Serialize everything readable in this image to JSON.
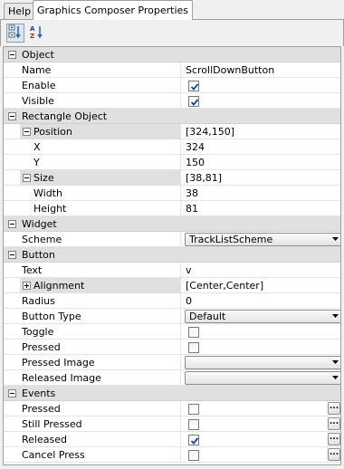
{
  "tabs": [
    {
      "label": "Help"
    },
    {
      "label": "Graphics Composer Properties"
    }
  ],
  "toolbar": {
    "categorized_icon": "categorized-view-icon",
    "alpha_icon": "alphabetical-sort-icon"
  },
  "categories": {
    "object": "Object",
    "rectangle": "Rectangle Object",
    "widget": "Widget",
    "button": "Button",
    "events": "Events"
  },
  "props": {
    "name": {
      "label": "Name",
      "value": "ScrollDownButton"
    },
    "enable": {
      "label": "Enable",
      "checked": true
    },
    "visible": {
      "label": "Visible",
      "checked": true
    },
    "position": {
      "label": "Position",
      "value": "[324,150]"
    },
    "x": {
      "label": "X",
      "value": "324"
    },
    "y": {
      "label": "Y",
      "value": "150"
    },
    "size": {
      "label": "Size",
      "value": "[38,81]"
    },
    "width": {
      "label": "Width",
      "value": "38"
    },
    "height": {
      "label": "Height",
      "value": "81"
    },
    "scheme": {
      "label": "Scheme",
      "value": "TrackListScheme"
    },
    "text": {
      "label": "Text",
      "value": "v"
    },
    "alignment": {
      "label": "Alignment",
      "value": "[Center,Center]"
    },
    "radius": {
      "label": "Radius",
      "value": "0"
    },
    "button_type": {
      "label": "Button Type",
      "value": "Default"
    },
    "toggle": {
      "label": "Toggle",
      "checked": false
    },
    "pressed": {
      "label": "Pressed",
      "checked": false
    },
    "pressed_image": {
      "label": "Pressed Image",
      "value": ""
    },
    "released_image": {
      "label": "Released Image",
      "value": ""
    },
    "ev_pressed": {
      "label": "Pressed",
      "checked": false
    },
    "ev_still_pressed": {
      "label": "Still Pressed",
      "checked": false
    },
    "ev_released": {
      "label": "Released",
      "checked": true
    },
    "ev_cancel_press": {
      "label": "Cancel Press",
      "checked": false
    }
  },
  "ellipsis_label": "..."
}
